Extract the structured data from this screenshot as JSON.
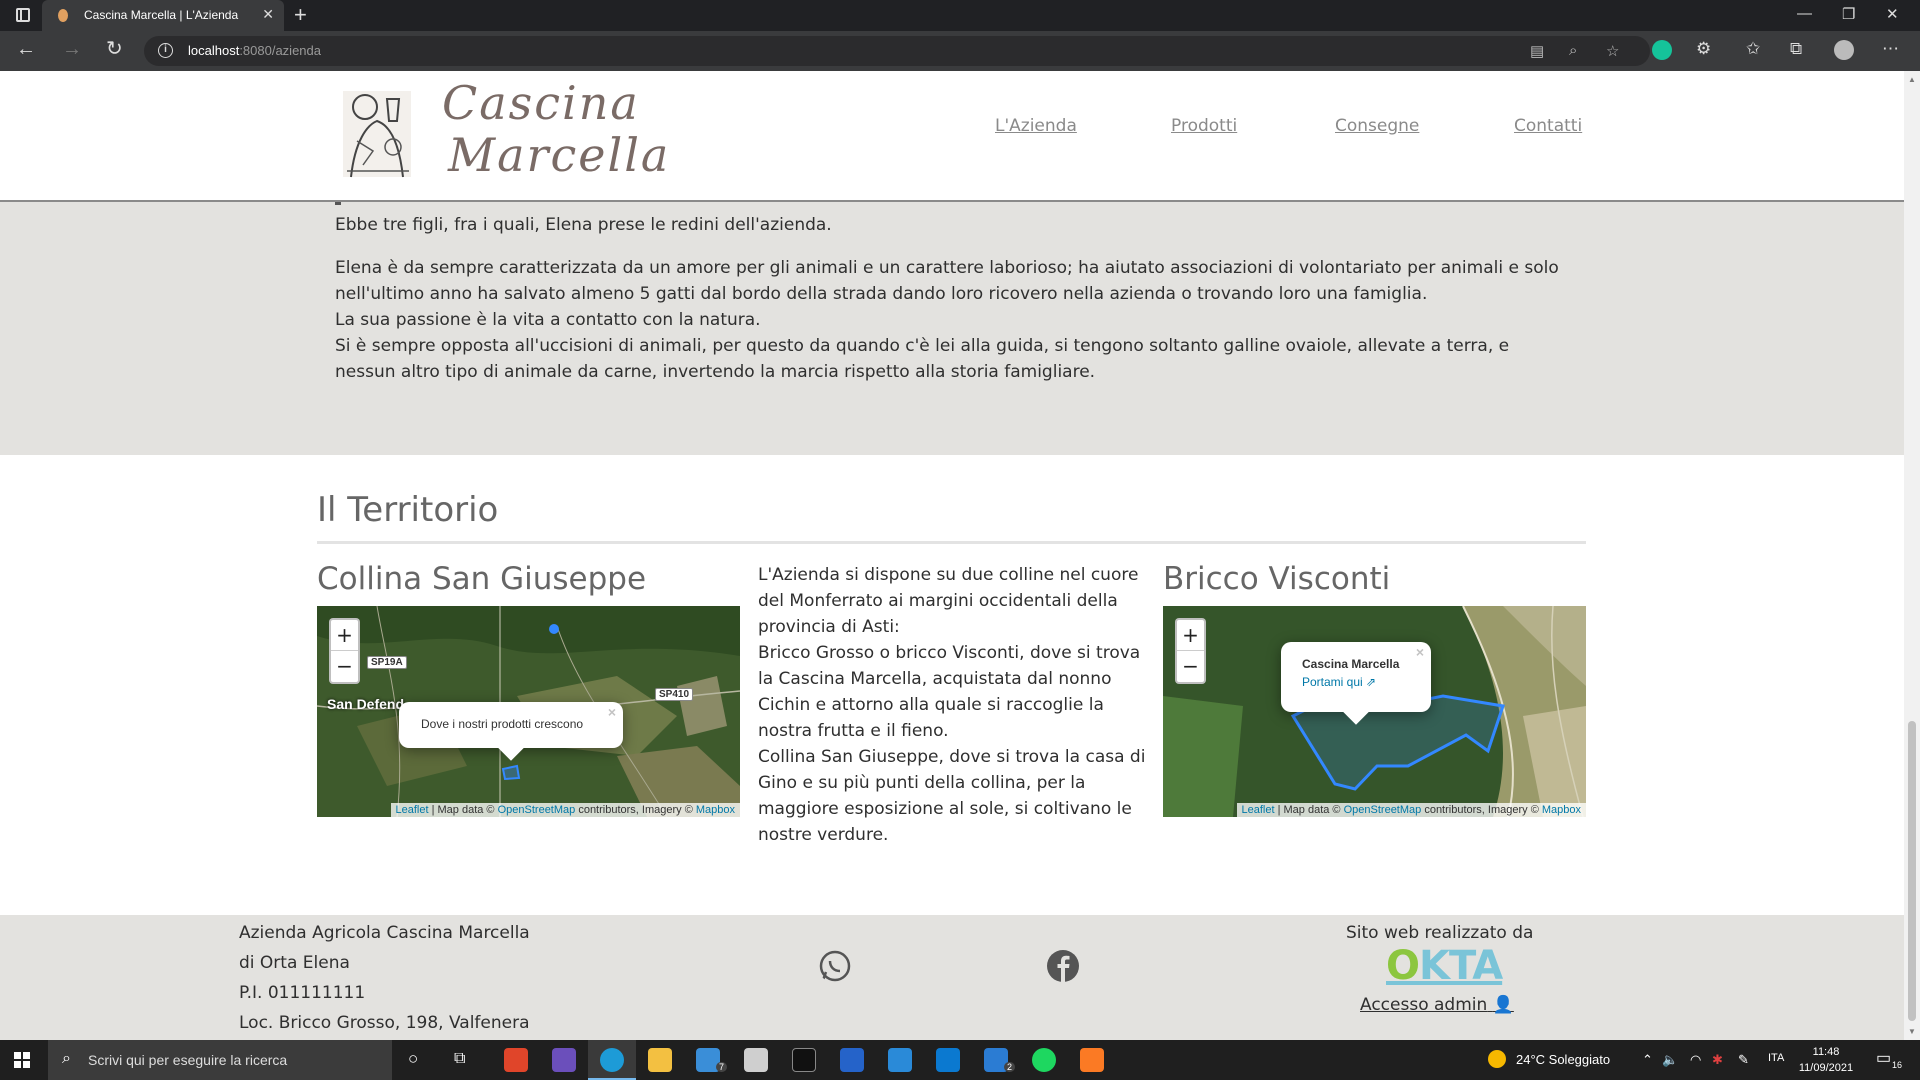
{
  "browser": {
    "tab_title": "Cascina Marcella | L'Azienda",
    "url_host": "localhost",
    "url_rest": ":8080/azienda"
  },
  "header": {
    "logo_line1": "Cascina",
    "logo_line2": "Marcella",
    "nav": [
      "L'Azienda",
      "Prodotti",
      "Consegne",
      "Contatti"
    ]
  },
  "story": {
    "paragraph1": "Ebbe tre figli, fra i quali, Elena prese le redini dell'azienda.",
    "paragraph2_lines": [
      "Elena è da sempre caratterizzata da un amore per gli animali e un carattere laborioso; ha aiutato associazioni di volontariato per animali e solo nell'ultimo anno ha salvato almeno 5 gatti dal bordo della strada dando loro ricovero nella azienda o trovando loro una famiglia.",
      "La sua passione è la vita a contatto con la natura.",
      "Si è sempre opposta all'uccisioni di animali, per questo da quando c'è lei alla guida, si tengono soltanto galline ovaiole, allevate a terra, e nessun altro tipo di animale da carne, invertendo la marcia rispetto alla storia famigliare."
    ]
  },
  "territory": {
    "title": "Il Territorio",
    "left_title": "Collina San Giuseppe",
    "right_title": "Bricco Visconti",
    "text_lines": [
      "L'Azienda si dispone su due colline nel cuore del Monferrato ai margini occidentali della provincia di Asti:",
      "Bricco Grosso o bricco Visconti, dove si trova la Cascina Marcella, acquistata dal nonno Cichin e attorno alla quale si raccoglie la nostra frutta e il fieno.",
      "Collina San Giuseppe, dove si trova la casa di Gino e su più punti della collina, per la maggiore esposizione al sole, si coltivano le nostre verdure."
    ],
    "map_left": {
      "popup": "Dove i nostri prodotti crescono",
      "roads": [
        "SP19A",
        "SP410"
      ],
      "town": "San Defend"
    },
    "map_right": {
      "popup_title": "Cascina Marcella",
      "popup_link": "Portami qui"
    },
    "zoom_in": "+",
    "zoom_out": "−",
    "attribution": {
      "leaflet": "Leaflet",
      "sep1": " | Map data © ",
      "osm": "OpenStreetMap",
      "sep2": " contributors, Imagery © ",
      "mapbox": "Mapbox"
    }
  },
  "footer": {
    "lines": [
      "Azienda Agricola Cascina Marcella",
      "di Orta Elena",
      "P.I. 011111111",
      "Loc. Bricco Grosso, 198, Valfenera"
    ],
    "credit": "Sito web realizzato da",
    "logo": "OKTA",
    "admin": "Accesso admin"
  },
  "taskbar": {
    "search_placeholder": "Scrivi qui per eseguire la ricerca",
    "weather": "24°C  Soleggiato",
    "lang": "ITA",
    "time": "11:48",
    "date": "11/09/2021",
    "notif": "16",
    "mail_badge": "7",
    "word_badge": "2"
  },
  "colors": {
    "accent_blue": "#3388ff",
    "footer_bg": "#e3e2df",
    "okta_green": "#8cc63f",
    "okta_blue": "#7ac4d8"
  }
}
